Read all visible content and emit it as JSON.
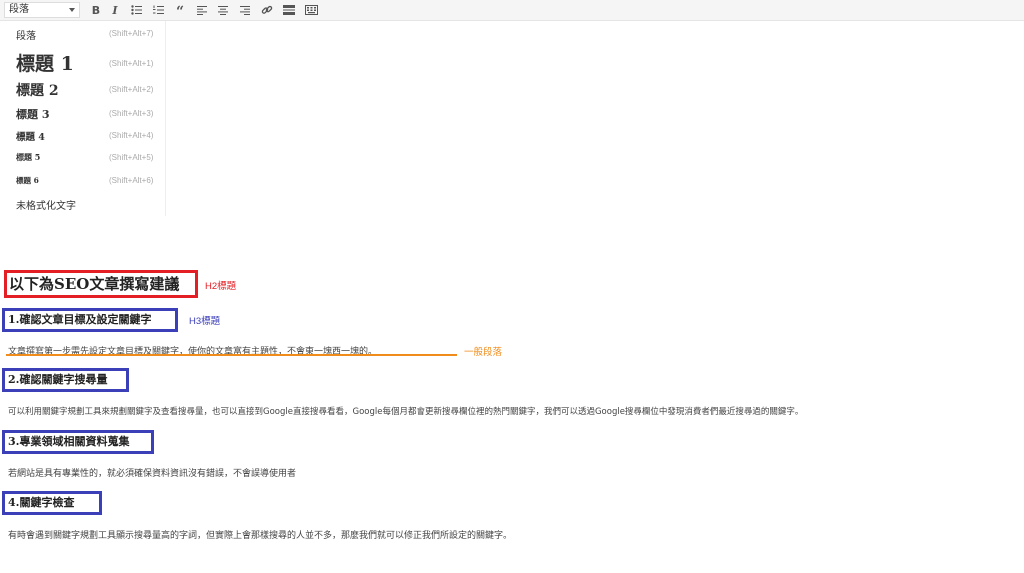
{
  "toolbar": {
    "format_value": "段落",
    "buttons": [
      {
        "name": "bold-button",
        "icon": "bold-icon"
      },
      {
        "name": "italic-button",
        "icon": "italic-icon"
      },
      {
        "name": "bullet-list-button",
        "icon": "bullet-list-icon"
      },
      {
        "name": "numbered-list-button",
        "icon": "numbered-list-icon"
      },
      {
        "name": "blockquote-button",
        "icon": "quote-icon"
      },
      {
        "name": "align-left-button",
        "icon": "align-left-icon"
      },
      {
        "name": "align-center-button",
        "icon": "align-center-icon"
      },
      {
        "name": "align-right-button",
        "icon": "align-right-icon"
      },
      {
        "name": "insert-link-button",
        "icon": "link-icon"
      },
      {
        "name": "read-more-button",
        "icon": "read-more-icon"
      },
      {
        "name": "toolbar-toggle-button",
        "icon": "keyboard-icon"
      }
    ]
  },
  "format_menu": {
    "items": [
      {
        "label": "段落",
        "shortcut": "(Shift+Alt+7)"
      },
      {
        "label": "標題 1",
        "shortcut": "(Shift+Alt+1)"
      },
      {
        "label": "標題 2",
        "shortcut": "(Shift+Alt+2)"
      },
      {
        "label": "標題 3",
        "shortcut": "(Shift+Alt+3)"
      },
      {
        "label": "標題 4",
        "shortcut": "(Shift+Alt+4)"
      },
      {
        "label": "標題 5",
        "shortcut": "(Shift+Alt+5)"
      },
      {
        "label": "標題 6",
        "shortcut": "(Shift+Alt+6)"
      },
      {
        "label": "未格式化文字",
        "shortcut": ""
      }
    ]
  },
  "content": {
    "h2": "以下為SEO文章撰寫建議",
    "h2_note": "H2標題",
    "h3_1": "1.確認文章目標及設定關鍵字",
    "h3_note": "H3標題",
    "p1": "文章撰寫第一步需先設定文章目標及關鍵字，使你的文章富有主題性，不會東一塊西一塊的。",
    "p_note": "一般段落",
    "h3_2": "2.確認關鍵字搜尋量",
    "p2": "可以利用關鍵字規劃工具來規劃關鍵字及查看搜尋量，也可以直接到Google直接搜尋看看，Google每個月都會更新搜尋欄位裡的熱門關鍵字，我們可以透過Google搜尋欄位中發現消費者們最近搜尋過的關鍵字。",
    "h3_3": "3.專業領域相關資料蒐集",
    "p3": "若網站是具有專業性的，就必須確保資料資訊沒有錯誤，不會誤導使用者",
    "h3_4": "4.關鍵字檢查",
    "p4": "有時會遇到關鍵字規劃工具顯示搜尋量高的字詞，但實際上會那樣搜尋的人並不多，那麼我們就可以修正我們所設定的關鍵字。"
  },
  "colors": {
    "h2_box": "#e31e24",
    "h3_box": "#3b3fb8",
    "h2_note": "#e31e24",
    "h3_note": "#3b3fb8",
    "p_note": "#f08c1a"
  }
}
